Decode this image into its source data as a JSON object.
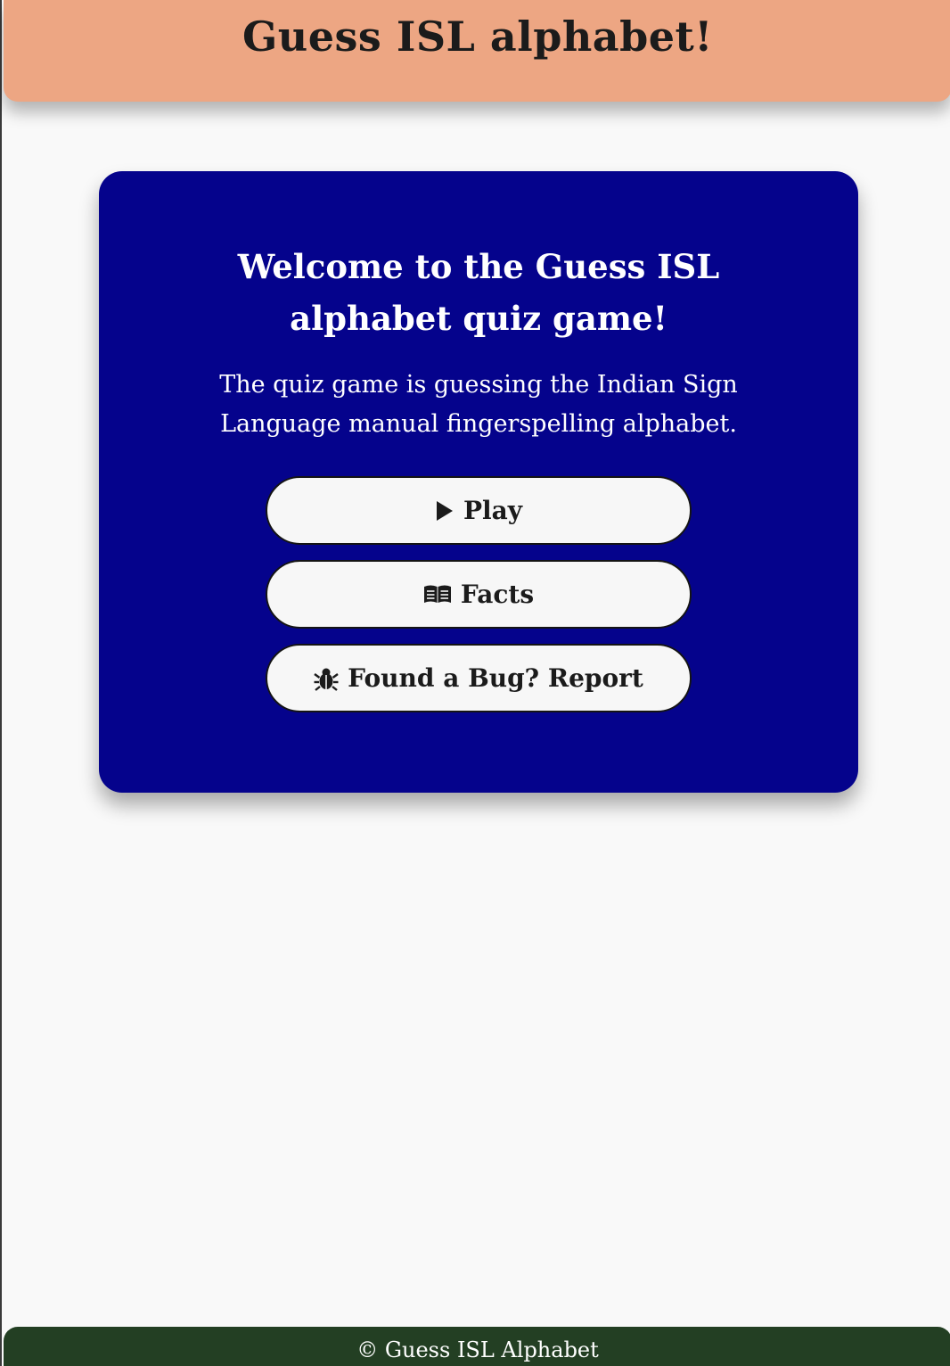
{
  "header": {
    "title": "Guess ISL alphabet!"
  },
  "card": {
    "heading": "Welcome to the Guess ISL alphabet quiz game!",
    "description": "The quiz game is guessing the Indian Sign Language manual fingerspelling alphabet.",
    "buttons": [
      {
        "label": "Play",
        "icon": "play-icon"
      },
      {
        "label": "Facts",
        "icon": "book-icon"
      },
      {
        "label": "Found a Bug? Report",
        "icon": "bug-icon"
      }
    ]
  },
  "footer": {
    "text": "© Guess ISL Alphabet"
  },
  "colors": {
    "header_bg": "#eda683",
    "card_bg": "#05038c",
    "footer_bg": "#233f23",
    "button_bg": "#f7f7f7",
    "page_bg": "#f9f9f9"
  }
}
